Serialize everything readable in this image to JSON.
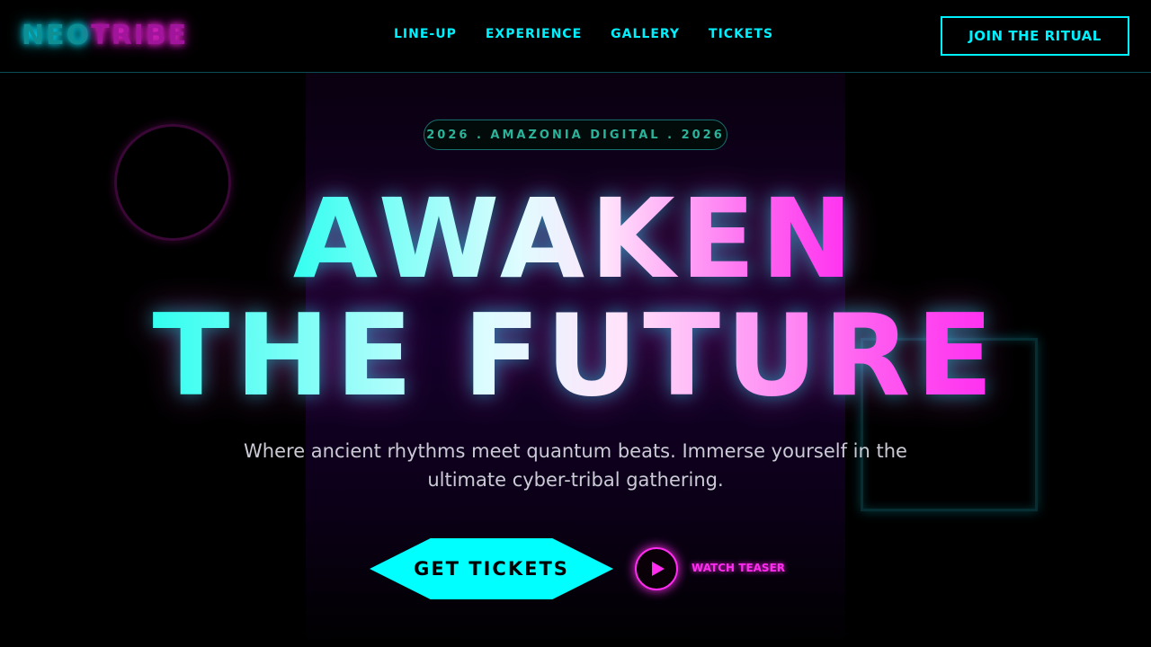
{
  "header": {
    "logo": {
      "part1": "NEO",
      "part2": "TRIBE"
    },
    "nav": [
      {
        "label": "LINE-UP"
      },
      {
        "label": "EXPERIENCE"
      },
      {
        "label": "GALLERY"
      },
      {
        "label": "TICKETS"
      }
    ],
    "cta_label": "JOIN THE RITUAL"
  },
  "hero": {
    "badge": "2026 . AMAZONIA DIGITAL . 2026",
    "headline_line1": "AWAKEN",
    "headline_line2": "THE FUTURE",
    "subtitle": "Where ancient rhythms meet quantum beats. Immerse yourself in the ultimate cyber-tribal gathering.",
    "primary_button": "GET TICKETS",
    "teaser_label": "WATCH TEASER"
  },
  "colors": {
    "cyan": "#00ffff",
    "magenta": "#ff2cf0",
    "background": "#000000"
  },
  "icons": {
    "play": "play-icon"
  }
}
